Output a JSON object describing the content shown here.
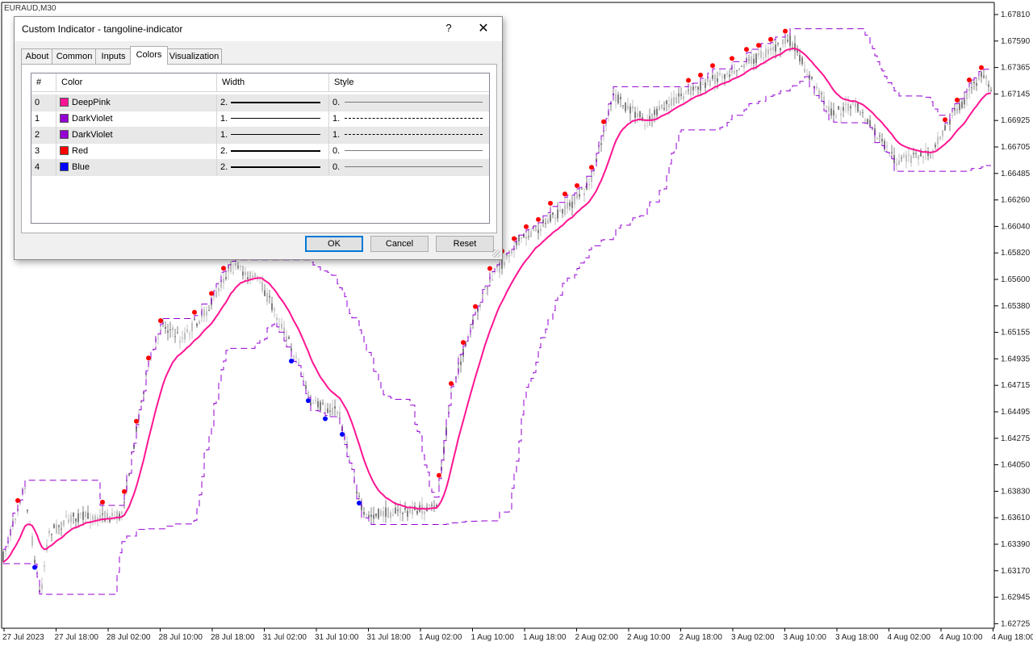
{
  "chart": {
    "symbol": "EURAUD,M30",
    "price_labels": [
      "1.67810",
      "1.67590",
      "1.67365",
      "1.67145",
      "1.66925",
      "1.66705",
      "1.66485",
      "1.66260",
      "1.66040",
      "1.65820",
      "1.65600",
      "1.65380",
      "1.65155",
      "1.64935",
      "1.64715",
      "1.64495",
      "1.64275",
      "1.64050",
      "1.63830",
      "1.63610",
      "1.63390",
      "1.63170",
      "1.62945",
      "1.62725"
    ],
    "time_labels": [
      "27 Jul 2023",
      "27 Jul 18:00",
      "28 Jul 02:00",
      "28 Jul 10:00",
      "28 Jul 18:00",
      "31 Jul 02:00",
      "31 Jul 10:00",
      "31 Jul 18:00",
      "1 Aug 02:00",
      "1 Aug 10:00",
      "1 Aug 18:00",
      "2 Aug 02:00",
      "2 Aug 10:00",
      "2 Aug 18:00",
      "3 Aug 02:00",
      "3 Aug 10:00",
      "3 Aug 18:00",
      "4 Aug 02:00",
      "4 Aug 10:00",
      "4 Aug 18:00"
    ],
    "colors": {
      "mid_line": "#ff1493",
      "channel": "#9400d3",
      "up_dot": "#ff0000",
      "down_dot": "#0000ff",
      "bull": "#c0c0c0",
      "bear": "#808080"
    }
  },
  "dialog": {
    "title": "Custom Indicator - tangoline-indicator",
    "help_glyph": "?",
    "close_glyph": "✕",
    "tabs": [
      {
        "label": "About"
      },
      {
        "label": "Common"
      },
      {
        "label": "Inputs"
      },
      {
        "label": "Colors"
      },
      {
        "label": "Visualization"
      }
    ],
    "active_tab": "Colors",
    "table": {
      "headers": {
        "num": "#",
        "color": "Color",
        "width": "Width",
        "style": "Style"
      },
      "rows": [
        {
          "num": "0",
          "color_name": "DeepPink",
          "hex": "#ff1493",
          "width": "2.",
          "style": "0."
        },
        {
          "num": "1",
          "color_name": "DarkViolet",
          "hex": "#9400d3",
          "width": "1.",
          "style": "1."
        },
        {
          "num": "2",
          "color_name": "DarkViolet",
          "hex": "#9400d3",
          "width": "1.",
          "style": "1."
        },
        {
          "num": "3",
          "color_name": "Red",
          "hex": "#ff0000",
          "width": "2.",
          "style": "0."
        },
        {
          "num": "4",
          "color_name": "Blue",
          "hex": "#0000ff",
          "width": "2.",
          "style": "0."
        }
      ]
    },
    "buttons": {
      "ok": "OK",
      "cancel": "Cancel",
      "reset": "Reset"
    }
  }
}
